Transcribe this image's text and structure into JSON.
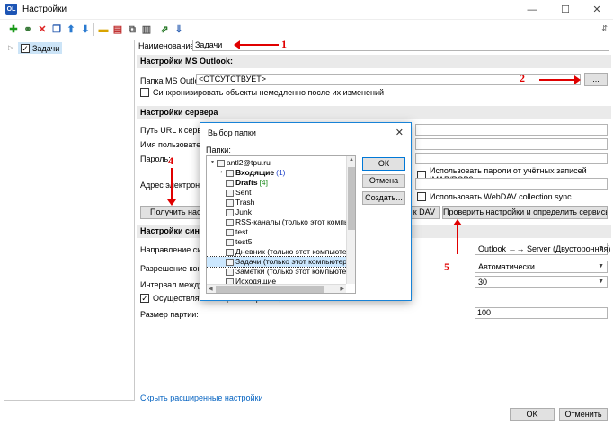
{
  "window": {
    "title": "Настройки",
    "app_icon": "OL",
    "minimize": "—",
    "maximize": "☐",
    "close": "✕"
  },
  "toolbar": {
    "icons": [
      "add-icon",
      "link-icon",
      "delete-icon",
      "copy-icon",
      "move-up-icon",
      "move-down-icon",
      "folder-icon",
      "clear-folder-icon",
      "duplicate-icon",
      "stack-icon",
      "export-icon",
      "import-icon"
    ],
    "more": "⇵"
  },
  "tree": {
    "expander": "▷",
    "checkbox_mark": "✓",
    "item_label": "Задачи"
  },
  "general": {
    "name_label": "Наименование:",
    "name_value": "Задачи"
  },
  "outlook": {
    "section_title": "Настройки MS Outlook:",
    "folder_label": "Папка MS Outlook:",
    "folder_value": "<ОТСУТСТВУЕТ>",
    "browse_label": "...",
    "sync_now_label": "Синхронизировать объекты немедленно после их изменений"
  },
  "server": {
    "section_title": "Настройки сервера",
    "url_label": "Путь URL к сервер",
    "user_label": "Имя пользовател",
    "password_label": "Пароль:",
    "email_label": "Адрес электронно",
    "imap_label": "Использовать пароли от учётных записей IMAP/POP3",
    "webdav_label": "Использовать WebDAV collection sync",
    "get_button": "Получить настр",
    "dav_button": "к DAV",
    "check_button": "Проверить настройки и определить сервисы"
  },
  "sync": {
    "section_title": "Настройки синх",
    "direction_label": "Направление син",
    "direction_value": "Outlook ←→ Server (Двусторонняя)",
    "conflict_label": "Разрешение конф",
    "conflict_value": "Автоматически",
    "interval_label": "Интервал между с",
    "interval_value": "30",
    "partial_label": "Осуществлять синхронизацию партиями объектов",
    "batch_label": "Размер партии:",
    "batch_value": "100"
  },
  "footer": {
    "hide_link": "Скрыть расширенные настройки",
    "ok": "OK",
    "cancel": "Отменить"
  },
  "dialog": {
    "title": "Выбор папки",
    "close": "✕",
    "folders_label": "Папки:",
    "ok": "ОК",
    "cancel": "Отмена",
    "create": "Создать...",
    "items": [
      {
        "label": "antl2@tpu.ru",
        "expander": "▾",
        "indent": 0
      },
      {
        "label": "Входящие",
        "count": "(1)",
        "count_style": "blue",
        "bold": true,
        "expander": "›",
        "indent": 1
      },
      {
        "label": "Drafts",
        "count": "[4]",
        "count_style": "green",
        "bold": true,
        "indent": 1
      },
      {
        "label": "Sent",
        "indent": 1
      },
      {
        "label": "Trash",
        "indent": 1
      },
      {
        "label": "Junk",
        "indent": 1
      },
      {
        "label": "RSS-каналы (только этот компь",
        "indent": 1
      },
      {
        "label": "test",
        "indent": 1
      },
      {
        "label": "test5",
        "indent": 1
      },
      {
        "label": "Дневник (только этот компьютер",
        "indent": 1
      },
      {
        "label": "Задачи (только этот компьютер",
        "indent": 1,
        "selected": true
      },
      {
        "label": "Заметки (только этот компьюте",
        "indent": 1
      },
      {
        "label": "Исходящие",
        "indent": 1
      }
    ]
  },
  "annotations": {
    "n1": "1",
    "n2": "2",
    "n3": "3",
    "n4": "4",
    "n5": "5"
  },
  "colors": {
    "annotation": "#e00000",
    "dialog_border": "#1883d7",
    "selection": "#cce8ff",
    "link": "#0563c1"
  }
}
